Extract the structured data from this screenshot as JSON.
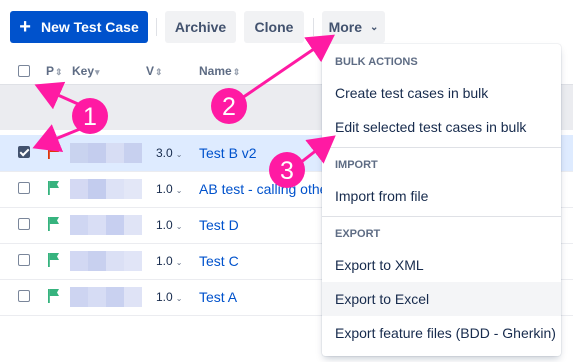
{
  "toolbar": {
    "new_label": "New Test Case",
    "archive_label": "Archive",
    "clone_label": "Clone",
    "more_label": "More"
  },
  "table": {
    "headers": {
      "priority": "P",
      "key": "Key",
      "version": "V",
      "name": "Name"
    },
    "rows": [
      {
        "selected": true,
        "priority_color": "#de350b",
        "version": "3.0",
        "name": "Test B v2"
      },
      {
        "selected": false,
        "priority_color": "#36b37e",
        "version": "1.0",
        "name": "AB test - calling othe"
      },
      {
        "selected": false,
        "priority_color": "#36b37e",
        "version": "1.0",
        "name": "Test D"
      },
      {
        "selected": false,
        "priority_color": "#36b37e",
        "version": "1.0",
        "name": "Test C"
      },
      {
        "selected": false,
        "priority_color": "#36b37e",
        "version": "1.0",
        "name": "Test A"
      }
    ]
  },
  "menu": {
    "bulk_header": "BULK ACTIONS",
    "create_bulk": "Create test cases in bulk",
    "edit_selected": "Edit selected test cases in bulk",
    "import_header": "IMPORT",
    "import_file": "Import from file",
    "export_header": "EXPORT",
    "export_xml": "Export to XML",
    "export_excel": "Export to Excel",
    "export_feature": "Export feature files (BDD - Gherkin)"
  },
  "annotations": {
    "marker1": "1",
    "marker2": "2",
    "marker3": "3",
    "color": "#ff1aa3"
  },
  "colors": {
    "primary": "#0052cc",
    "selected_row": "#deebff",
    "link": "#0052cc"
  }
}
